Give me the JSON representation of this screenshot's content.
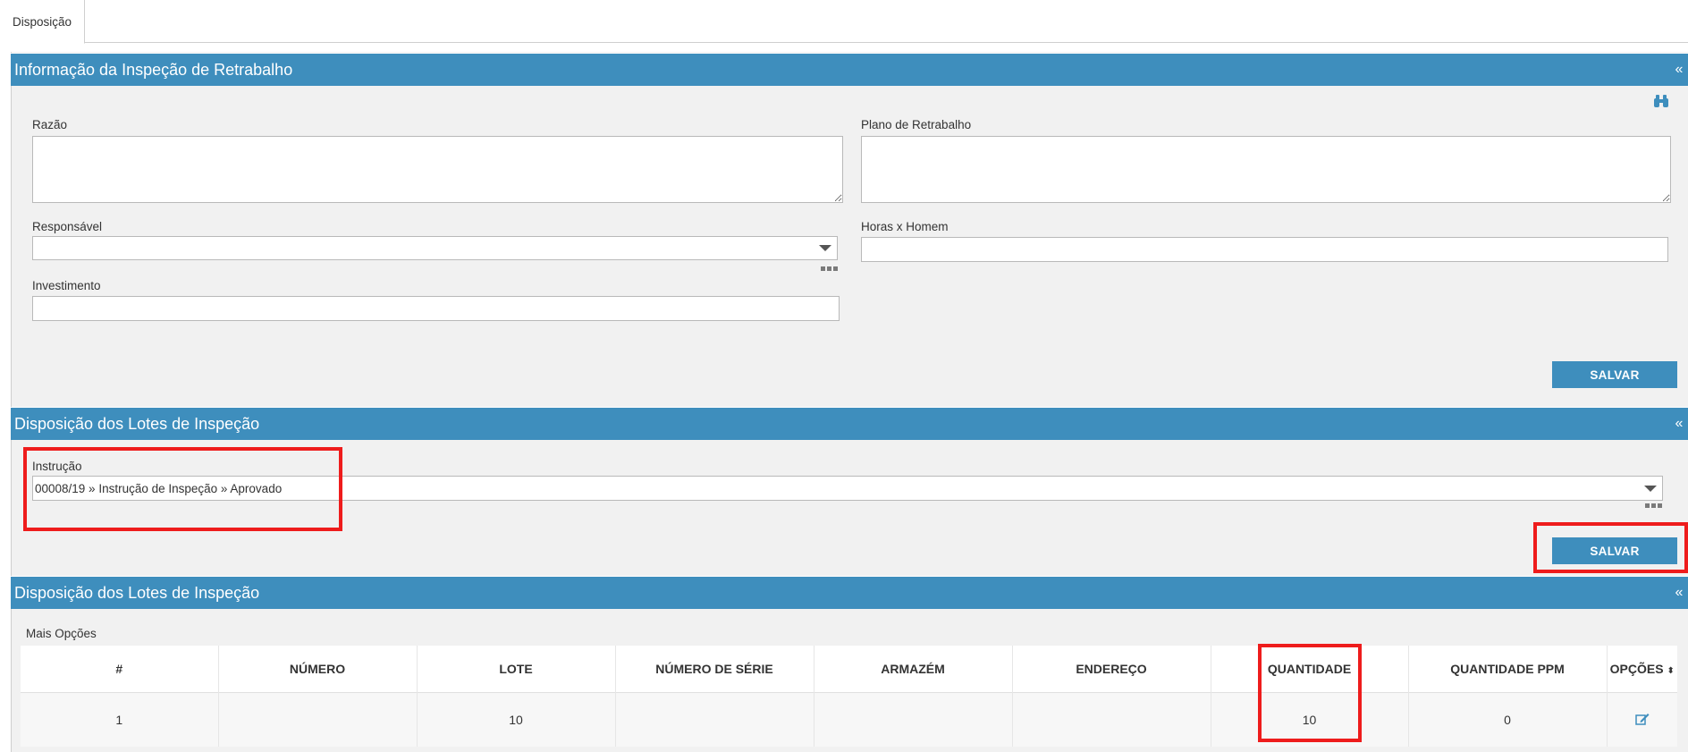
{
  "tabs": [
    {
      "label": "Disposição"
    }
  ],
  "panel1": {
    "title": "Informação da Inspeção de Retrabalho",
    "collapse": "«",
    "razao_label": "Razão",
    "razao_value": "",
    "plano_label": "Plano de Retrabalho",
    "plano_value": "",
    "responsavel_label": "Responsável",
    "responsavel_value": "",
    "horas_label": "Horas x Homem",
    "horas_value": "",
    "investimento_label": "Investimento",
    "investimento_value": "",
    "save_label": "SALVAR"
  },
  "panel2": {
    "title": "Disposição dos Lotes de Inspeção",
    "collapse": "«",
    "instrucao_label": "Instrução",
    "instrucao_value": "00008/19 » Instrução de Inspeção » Aprovado",
    "save_label": "SALVAR"
  },
  "panel3": {
    "title": "Disposição dos Lotes de Inspeção",
    "collapse": "«",
    "more_options": "Mais Opções",
    "columns": [
      "#",
      "NÚMERO",
      "LOTE",
      "NÚMERO DE SÉRIE",
      "ARMAZÉM",
      "ENDEREÇO",
      "QUANTIDADE",
      "QUANTIDADE PPM",
      "OPÇÕES"
    ],
    "sort_glyph": "⬍",
    "rows": [
      {
        "num": "1",
        "numero": "",
        "lote": "10",
        "serie": "",
        "armazem": "",
        "endereco": "",
        "quantidade": "10",
        "ppm": "0",
        "option_icon": "edit-icon"
      }
    ]
  },
  "colors": {
    "header": "#3e8ebd",
    "button": "#3e8ebd",
    "highlight": "#ee1c1c",
    "panel_bg": "#f1f1f1"
  }
}
